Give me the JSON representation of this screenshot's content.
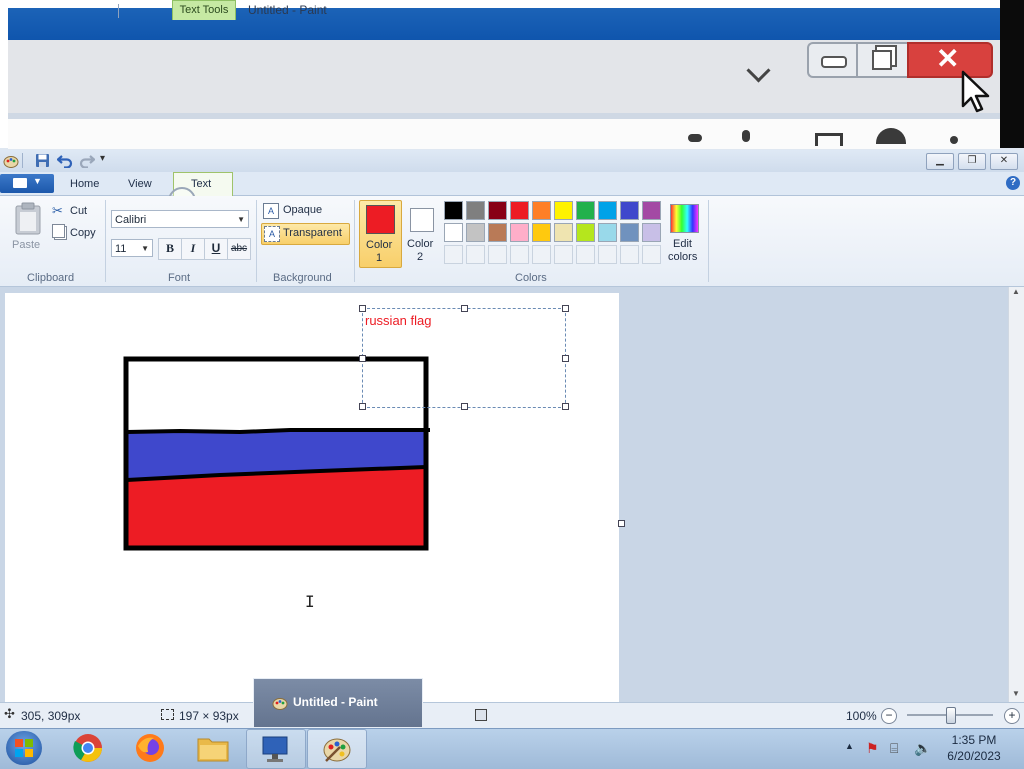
{
  "window": {
    "title": "Untitled - Paint",
    "contextual_tab_group": "Text Tools"
  },
  "tabs": [
    {
      "label": "Home",
      "active": false
    },
    {
      "label": "View",
      "active": false
    },
    {
      "label": "Text",
      "active": true
    }
  ],
  "clipboard": {
    "paste": "Paste",
    "cut": "Cut",
    "copy": "Copy",
    "group_label": "Clipboard"
  },
  "font": {
    "family": "Calibri",
    "size": "11",
    "bold": "B",
    "italic": "I",
    "underline": "U",
    "strikethrough": "abc",
    "group_label": "Font"
  },
  "background": {
    "opaque": "Opaque",
    "transparent": "Transparent",
    "selected": "Transparent",
    "group_label": "Background"
  },
  "colors": {
    "color1_label": "Color",
    "color1_num": "1",
    "color1_value": "#ed1c24",
    "color2_label": "Color",
    "color2_num": "2",
    "color2_value": "#ffffff",
    "edit_colors_line1": "Edit",
    "edit_colors_line2": "colors",
    "group_label": "Colors",
    "palette_row1": [
      "#000000",
      "#7f7f7f",
      "#880015",
      "#ed1c24",
      "#ff7f27",
      "#fff200",
      "#22b14c",
      "#00a2e8",
      "#3f48cc",
      "#a349a4"
    ],
    "palette_row2": [
      "#ffffff",
      "#c3c3c3",
      "#b97a57",
      "#ffaec9",
      "#ffc90e",
      "#efe4b0",
      "#b5e61d",
      "#99d9ea",
      "#7092be",
      "#c8bfe7"
    ]
  },
  "canvas": {
    "text_content": "russian flag",
    "text_color": "#ed1c24",
    "flag_stripes": [
      "#ffffff",
      "#3f48cc",
      "#ed1c24"
    ]
  },
  "status": {
    "cursor_pos": "305, 309px",
    "selection_size": "197 × 93px",
    "zoom": "100%"
  },
  "taskbar": {
    "preview_title": "Untitled - Paint",
    "time": "1:35 PM",
    "date": "6/20/2023"
  }
}
